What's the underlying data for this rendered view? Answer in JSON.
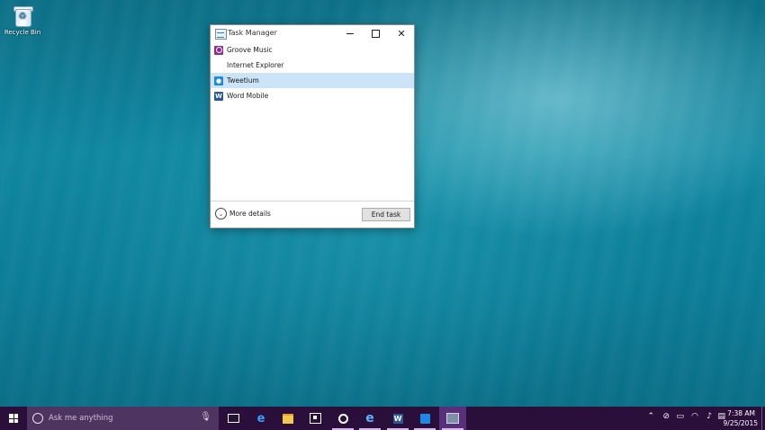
{
  "desktop": {
    "recycle_bin_label": "Recycle Bin"
  },
  "task_manager": {
    "title": "Task Manager",
    "apps": [
      {
        "name": "Groove Music",
        "icon": "groove-music-icon",
        "selected": false
      },
      {
        "name": "Internet Explorer",
        "icon": "internet-explorer-icon",
        "selected": false
      },
      {
        "name": "Tweetium",
        "icon": "tweetium-icon",
        "selected": true
      },
      {
        "name": "Word Mobile",
        "icon": "word-mobile-icon",
        "selected": false
      }
    ],
    "more_details_label": "More details",
    "end_task_label": "End task"
  },
  "taskbar": {
    "search_placeholder": "Ask me anything",
    "pinned": [
      "task-view",
      "edge",
      "file-explorer",
      "store",
      "groove-music",
      "internet-explorer",
      "word-mobile",
      "tweetium",
      "task-manager"
    ],
    "active_app": "task-manager",
    "accent_color": "#2a0f3b",
    "search_bg": "#4e3561"
  },
  "clock": {
    "time": "7:38 AM",
    "date": "9/25/2015"
  },
  "colors": {
    "selection": "#cce4f7"
  }
}
